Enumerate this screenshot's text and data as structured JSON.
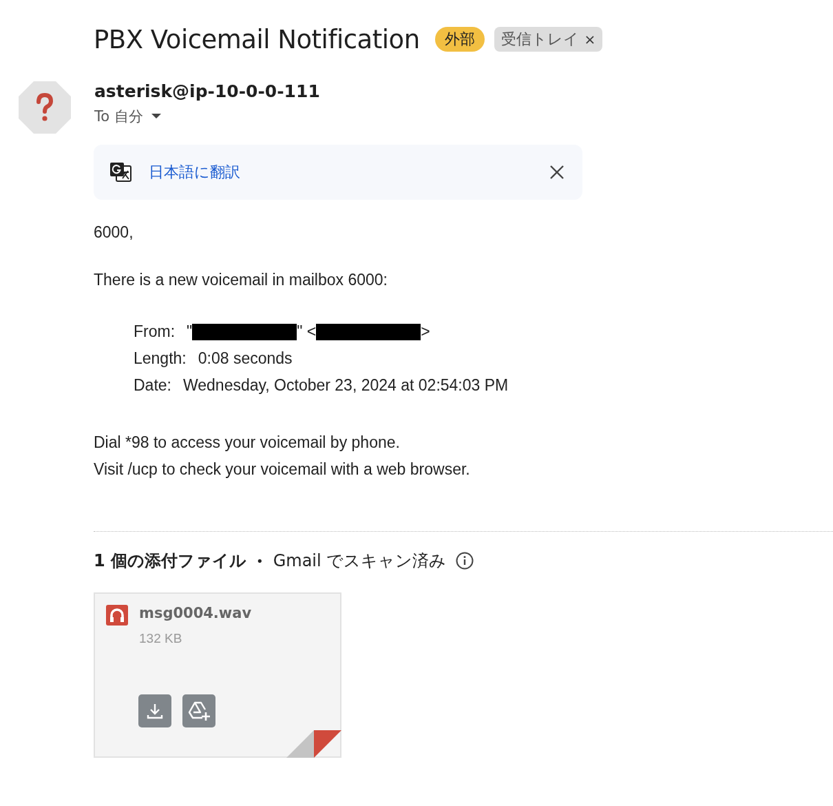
{
  "subject": "PBX Voicemail Notification",
  "labels": [
    {
      "kind": "external",
      "text": "外部"
    },
    {
      "kind": "folder",
      "text": "受信トレイ",
      "remove": "×"
    }
  ],
  "sender": {
    "address": "asterisk@ip-10-0-0-111",
    "recipient": "To 自分"
  },
  "translate": {
    "link": "日本語に翻訳"
  },
  "body": [
    {
      "kind": "para",
      "text": "6000,"
    },
    {
      "kind": "para",
      "text": "There is a new voicemail in mailbox 6000:"
    },
    {
      "kind": "fields",
      "rows": [
        {
          "label": "From:",
          "parts": [
            {
              "kind": "text",
              "text": "\""
            },
            {
              "kind": "redaction"
            },
            {
              "kind": "text",
              "text": "\" <"
            },
            {
              "kind": "redaction"
            },
            {
              "kind": "text",
              "text": ">"
            }
          ]
        },
        {
          "label": "Length:",
          "parts": [
            {
              "kind": "text",
              "text": "0:08 seconds"
            }
          ]
        },
        {
          "label": "Date:",
          "parts": [
            {
              "kind": "text",
              "text": "Wednesday, October 23, 2024 at 02:54:03 PM"
            }
          ]
        }
      ]
    },
    {
      "kind": "lines",
      "lines": [
        "Dial *98 to access your voicemail by phone.",
        "Visit /ucp to check your voicemail with a web browser."
      ]
    }
  ],
  "attachments": {
    "count": "1 個の添付ファイル",
    "separator": "•",
    "scan": "Gmail でスキャン済み",
    "files": [
      {
        "name": "msg0004.wav",
        "size": "132 KB"
      }
    ]
  }
}
